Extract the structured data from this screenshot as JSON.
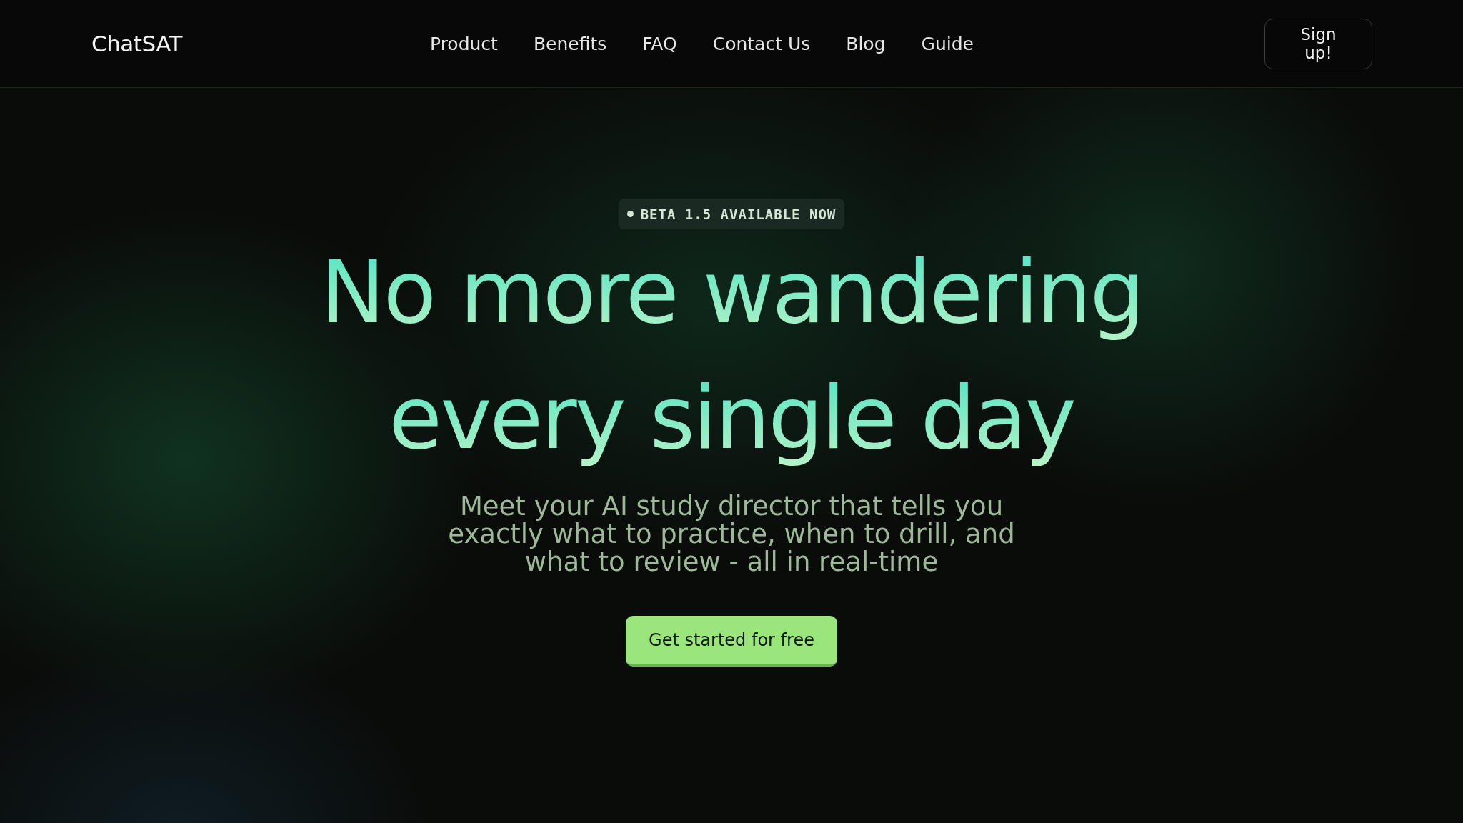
{
  "header": {
    "logo": "ChatSAT",
    "nav": [
      {
        "label": "Product"
      },
      {
        "label": "Benefits"
      },
      {
        "label": "FAQ"
      },
      {
        "label": "Contact Us"
      },
      {
        "label": "Blog"
      },
      {
        "label": "Guide"
      }
    ],
    "signup_button": "Sign up!"
  },
  "hero": {
    "badge": "BETA 1.5 AVAILABLE NOW",
    "headline": [
      "No more wandering",
      "every single day"
    ],
    "subtitle": "Meet your AI study director that tells you exactly what to practice, when to drill, and what to review - all in real-time",
    "cta_button": "Get started for free"
  }
}
